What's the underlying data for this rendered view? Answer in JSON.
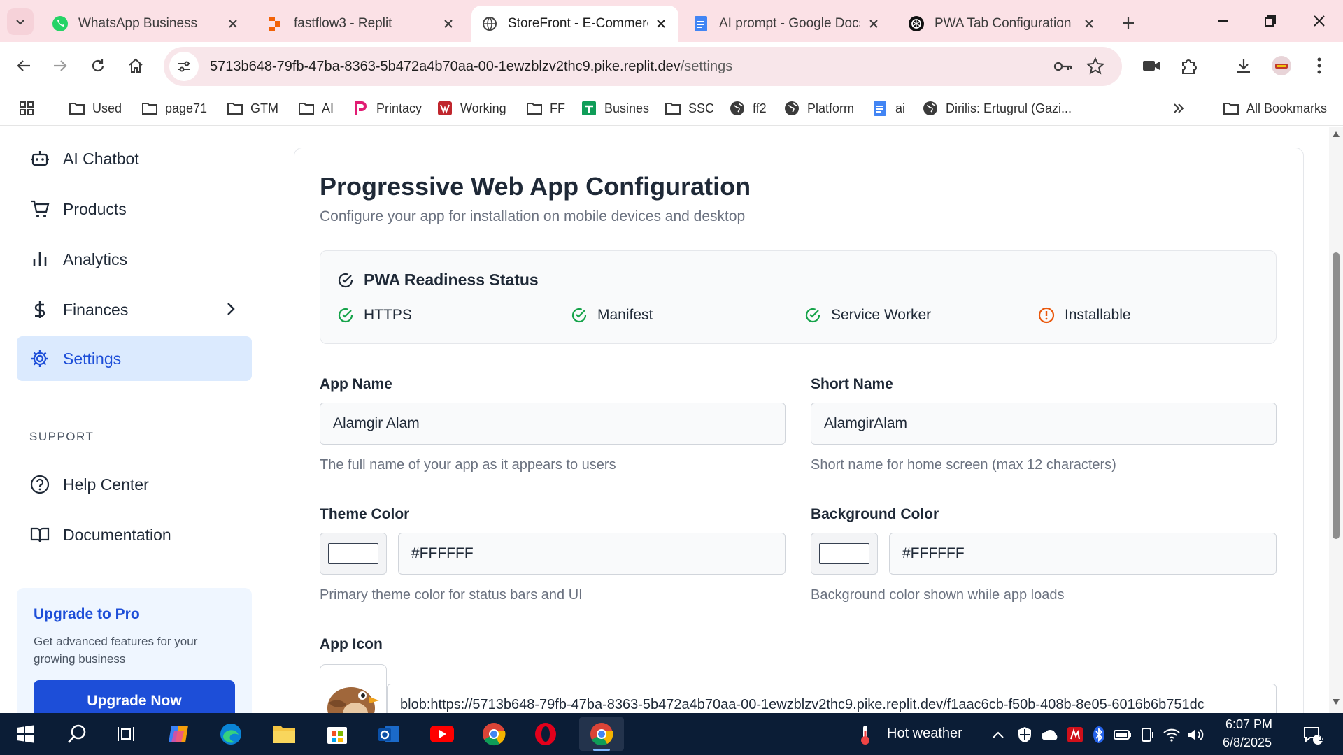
{
  "browser": {
    "tabs": [
      {
        "title": "WhatsApp Business",
        "icon": "whatsapp-icon",
        "active": false
      },
      {
        "title": "fastflow3 - Replit",
        "icon": "replit-icon",
        "active": false
      },
      {
        "title": "StoreFront - E-Commerce",
        "icon": "globe-icon",
        "active": true
      },
      {
        "title": "AI prompt - Google Docs",
        "icon": "docs-icon",
        "active": false
      },
      {
        "title": "PWA Tab Configuration",
        "icon": "chatgpt-icon",
        "active": false
      }
    ],
    "url_host": "5713b648-79fb-47ba-8363-5b472a4b70aa-00-1ewzblzv2thc9.pike.replit.dev",
    "url_path": "/settings",
    "bookmarks": [
      "Used",
      "page71",
      "GTM",
      "AI",
      "Printacy",
      "Working",
      "FF",
      "Busines",
      "SSC",
      "ff2",
      "Platform",
      "ai",
      "Dirilis: Ertugrul (Gazi..."
    ],
    "all_bookmarks": "All Bookmarks"
  },
  "sidebar": {
    "items": [
      {
        "label": "AI Chatbot",
        "icon": "bot-icon"
      },
      {
        "label": "Products",
        "icon": "cart-icon"
      },
      {
        "label": "Analytics",
        "icon": "bar-chart-icon"
      },
      {
        "label": "Finances",
        "icon": "dollar-icon"
      },
      {
        "label": "Settings",
        "icon": "gear-icon"
      }
    ],
    "support_label": "SUPPORT",
    "support_items": [
      {
        "label": "Help Center",
        "icon": "help-circle-icon"
      },
      {
        "label": "Documentation",
        "icon": "book-icon"
      }
    ],
    "upgrade": {
      "title": "Upgrade to Pro",
      "description": "Get advanced features for your growing business",
      "button": "Upgrade Now"
    }
  },
  "main": {
    "title": "Progressive Web App Configuration",
    "subtitle": "Configure your app for installation on mobile devices and desktop",
    "status": {
      "title": "PWA Readiness Status",
      "items": [
        {
          "label": "HTTPS",
          "state": "ok"
        },
        {
          "label": "Manifest",
          "state": "ok"
        },
        {
          "label": "Service Worker",
          "state": "ok"
        },
        {
          "label": "Installable",
          "state": "warning"
        }
      ]
    },
    "app_name": {
      "label": "App Name",
      "value": "Alamgir Alam",
      "help": "The full name of your app as it appears to users"
    },
    "short_name": {
      "label": "Short Name",
      "value": "AlamgirAlam",
      "help": "Short name for home screen (max 12 characters)"
    },
    "theme_color": {
      "label": "Theme Color",
      "value": "#FFFFFF",
      "help": "Primary theme color for status bars and UI"
    },
    "background_color": {
      "label": "Background Color",
      "value": "#FFFFFF",
      "help": "Background color shown while app loads"
    },
    "app_icon": {
      "label": "App Icon",
      "value": "blob:https://5713b648-79fb-47ba-8363-5b472a4b70aa-00-1ewzblzv2thc9.pike.replit.dev/f1aac6cb-f50b-408b-8e05-6016b6b751dc"
    }
  },
  "taskbar": {
    "weather": "Hot weather",
    "time": "6:07 PM",
    "date": "6/8/2025",
    "notification_count": "1"
  },
  "colors": {
    "accent": "#1d4ed8",
    "active_nav_bg": "#dbeafe",
    "ok": "#16a34a",
    "warning": "#ea580c",
    "tabstrip": "#fbe1e6"
  }
}
